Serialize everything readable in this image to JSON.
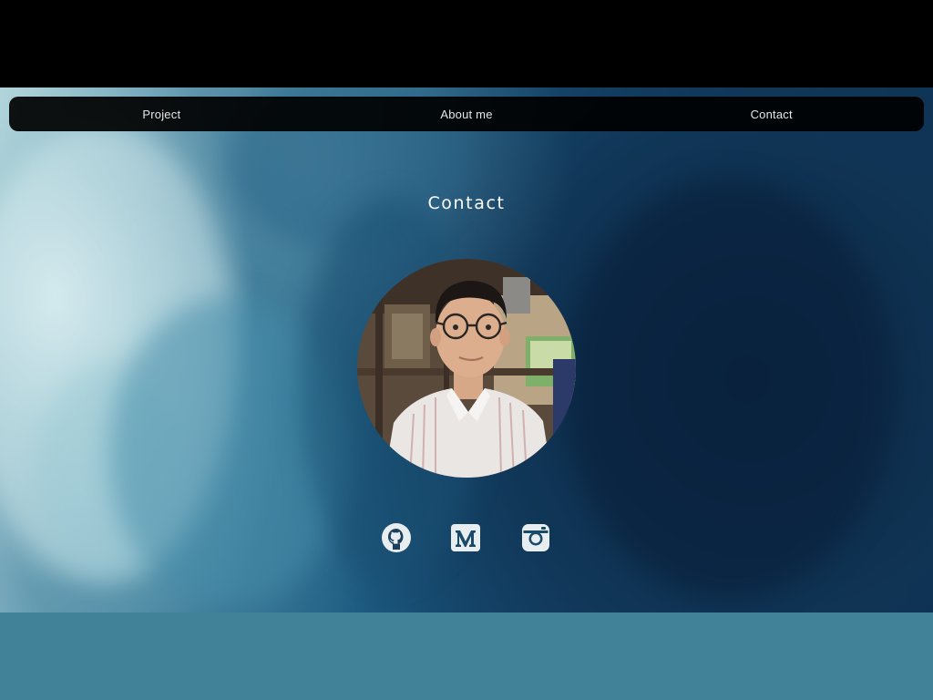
{
  "nav": {
    "items": [
      {
        "label": "Project"
      },
      {
        "label": "About me"
      },
      {
        "label": "Contact"
      }
    ]
  },
  "contact": {
    "title": "Contact"
  },
  "profile": {
    "photo": "profile-photo"
  },
  "socials": [
    {
      "icon": "github-icon"
    },
    {
      "icon": "medium-icon"
    },
    {
      "icon": "instagram-icon"
    }
  ],
  "colors": {
    "top_band": "#000000",
    "navbar": "#000000",
    "nav_text": "#e6e6e6",
    "title_text": "#ffffff",
    "icon_color": "#e8edf0",
    "footer_band": "#428298",
    "ocean_dark": "#0f3a60",
    "ocean_light": "#b6d6dc"
  }
}
